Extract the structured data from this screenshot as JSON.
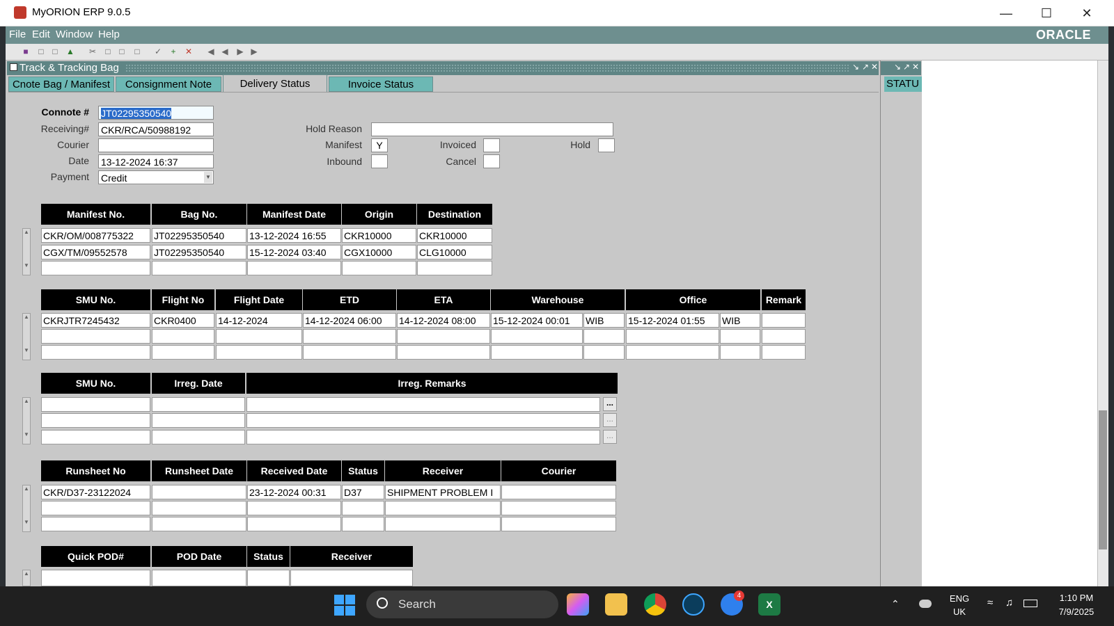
{
  "window": {
    "title": "MyORION ERP 9.0.5"
  },
  "menu": [
    "File",
    "Edit",
    "Window",
    "Help"
  ],
  "brand": "ORACLE",
  "form": {
    "title": "Track & Tracking Bag",
    "tabs": [
      "Cnote Bag / Manifest",
      "Consignment Note",
      "Delivery Status",
      "Invoice Status"
    ],
    "side_tab": "STATU"
  },
  "fields": {
    "connote_label": "Connote #",
    "connote_value": "JT02295350540",
    "receiving_label": "Receiving#",
    "receiving_value": "CKR/RCA/50988192",
    "courier_label": "Courier",
    "courier_value": "",
    "date_label": "Date",
    "date_value": "13-12-2024 16:37",
    "payment_label": "Payment",
    "payment_value": "Credit",
    "hold_reason_label": "Hold Reason",
    "hold_reason_value": "",
    "manifest_label": "Manifest",
    "manifest_value": "Y",
    "inbound_label": "Inbound",
    "inbound_value": "",
    "invoiced_label": "Invoiced",
    "invoiced_value": "",
    "cancel_label": "Cancel",
    "cancel_value": "",
    "hold_label": "Hold",
    "hold_value": ""
  },
  "manifest_table": {
    "headers": [
      "Manifest No.",
      "Bag No.",
      "Manifest Date",
      "Origin",
      "Destination"
    ],
    "rows": [
      [
        "CKR/OM/008775322",
        "JT02295350540",
        "13-12-2024 16:55",
        "CKR10000",
        "CKR10000"
      ],
      [
        "CGX/TM/09552578",
        "JT02295350540",
        "15-12-2024 03:40",
        "CGX10000",
        "CLG10000"
      ],
      [
        "",
        "",
        "",
        "",
        ""
      ]
    ]
  },
  "smu_table": {
    "headers": [
      "SMU No.",
      "Flight No",
      "Flight Date",
      "ETD",
      "ETA",
      "Warehouse",
      "Office",
      "Remark"
    ],
    "rows": [
      [
        "CKRJTR7245432",
        "CKR0400",
        "14-12-2024",
        "14-12-2024 06:00",
        "14-12-2024 08:00",
        "15-12-2024 00:01",
        "WIB",
        "15-12-2024 01:55",
        "WIB",
        ""
      ],
      [
        "",
        "",
        "",
        "",
        "",
        "",
        "",
        "",
        "",
        ""
      ],
      [
        "",
        "",
        "",
        "",
        "",
        "",
        "",
        "",
        "",
        ""
      ]
    ]
  },
  "irreg_table": {
    "headers": [
      "SMU No.",
      "Irreg. Date",
      "Irreg. Remarks"
    ],
    "rows": [
      [
        "",
        "",
        ""
      ],
      [
        "",
        "",
        ""
      ],
      [
        "",
        "",
        ""
      ]
    ],
    "more_label": "..."
  },
  "runsheet_table": {
    "headers": [
      "Runsheet No",
      "Runsheet Date",
      "Received Date",
      "Status",
      "Receiver",
      "Courier"
    ],
    "rows": [
      [
        "CKR/D37-23122024",
        "",
        "23-12-2024 00:31",
        "D37",
        "SHIPMENT PROBLEM I",
        ""
      ],
      [
        "",
        "",
        "",
        "",
        "",
        ""
      ],
      [
        "",
        "",
        "",
        "",
        "",
        ""
      ]
    ]
  },
  "pod_table": {
    "headers": [
      "Quick POD#",
      "POD Date",
      "Status",
      "Receiver"
    ],
    "rows": [
      [
        "",
        "",
        "",
        ""
      ]
    ]
  },
  "taskbar": {
    "search_label": "Search",
    "lang_top": "ENG",
    "lang_bottom": "UK",
    "time": "1:10 PM",
    "date": "7/9/2025",
    "mail_badge": "4"
  }
}
